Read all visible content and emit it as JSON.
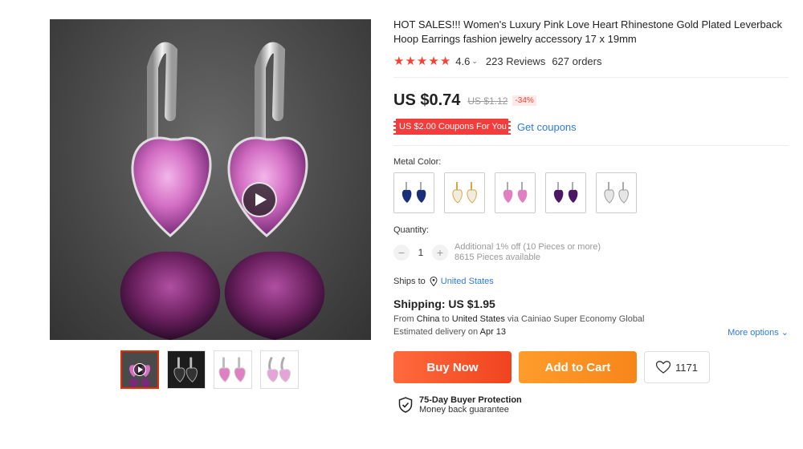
{
  "product": {
    "title": "HOT SALES!!! Women's Luxury Pink Love Heart Rhinestone Gold Plated Leverback Hoop Earrings fashion jewelry accessory 17 x 19mm",
    "rating": "4.6",
    "reviews": "223 Reviews",
    "orders": "627 orders",
    "price": "US $0.74",
    "old_price": "US $1.12",
    "discount": "-34%",
    "coupon": "US $2.00 Coupons For You",
    "get_coupons": "Get coupons"
  },
  "gallery": {
    "thumbnails": [
      "video-thumb",
      "dark-earring",
      "pink-earring",
      "pink-silver-earring"
    ]
  },
  "options": {
    "metal_label": "Metal Color:",
    "swatches": [
      {
        "name": "blue",
        "color": "#1a2f7a"
      },
      {
        "name": "gold-white",
        "color": "#f0ece0"
      },
      {
        "name": "pink",
        "color": "#e07fc2"
      },
      {
        "name": "purple",
        "color": "#4b1766"
      },
      {
        "name": "silver-white",
        "color": "#e6e6e6"
      }
    ]
  },
  "quantity": {
    "label": "Quantity:",
    "minus": "−",
    "plus": "+",
    "value": "1",
    "note1": "Additional 1% off (10 Pieces or more)",
    "note2": "8615 Pieces available"
  },
  "shipping": {
    "ships_to_label": "Ships to",
    "ships_to": "United States",
    "title": "Shipping: US $1.95",
    "from_label": "From",
    "from": "China",
    "to_label": "to",
    "to": "United States",
    "via": "via Cainiao Super Economy Global",
    "delivery_label": "Estimated delivery on",
    "delivery_date": "Apr 13",
    "more_options": "More options"
  },
  "actions": {
    "buy_now": "Buy Now",
    "add_to_cart": "Add to Cart",
    "wishlist_count": "1171"
  },
  "protection": {
    "title": "75-Day Buyer Protection",
    "subtitle": "Money back guarantee"
  },
  "colors": {
    "accent_red": "#f44336",
    "buy_now": "#f0441f",
    "add_to_cart": "#f7861a",
    "link_blue": "#2e7bd6"
  }
}
